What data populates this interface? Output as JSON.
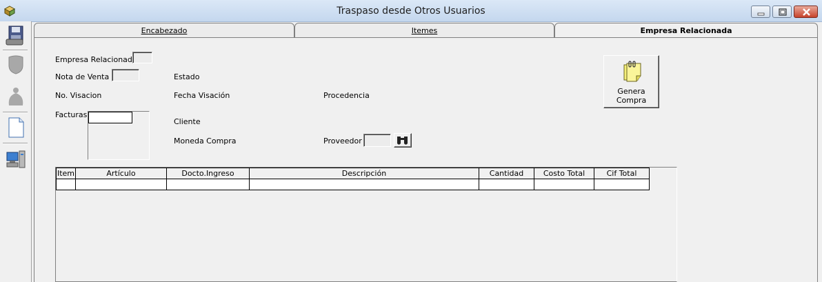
{
  "window": {
    "title": "Traspaso desde Otros Usuarios"
  },
  "icons": {
    "app": "app-icon",
    "toolbar": [
      "save-icon",
      "shield-icon",
      "bag-icon",
      "new-document-icon",
      "computer-icon"
    ],
    "genera_compra": "notepad-icon",
    "proveedor_search": "binoculars-icon"
  },
  "tabs": [
    {
      "label": "Encabezado",
      "active": false
    },
    {
      "label": "Itemes",
      "active": false
    },
    {
      "label": "Empresa Relacionada",
      "active": true
    }
  ],
  "form": {
    "empresa_relacionada_label": "Empresa Relacionada",
    "empresa_relacionada_value": "",
    "nota_venta_label": "Nota de Venta",
    "nota_venta_value": "",
    "estado_label": "Estado",
    "no_visacion_label": "No. Visacion",
    "fecha_visacion_label": "Fecha Visación",
    "procedencia_label": "Procedencia",
    "facturas_label": "Facturas",
    "cliente_label": "Cliente",
    "moneda_compra_label": "Moneda Compra",
    "proveedor_label": "Proveedor",
    "proveedor_value": ""
  },
  "genera_compra": {
    "line1": "Genera",
    "line2": "Compra"
  },
  "grid": {
    "columns": [
      "Item",
      "Artículo",
      "Docto.Ingreso",
      "Descripción",
      "Cantidad",
      "Costo Total",
      "Cif Total"
    ],
    "rows": [
      [
        "",
        "",
        "",
        "",
        "",
        "",
        ""
      ]
    ]
  },
  "colors": {
    "titlebar": "#c4d7ee",
    "close_button": "#c7432c",
    "window_bg": "#f0f0f0"
  }
}
